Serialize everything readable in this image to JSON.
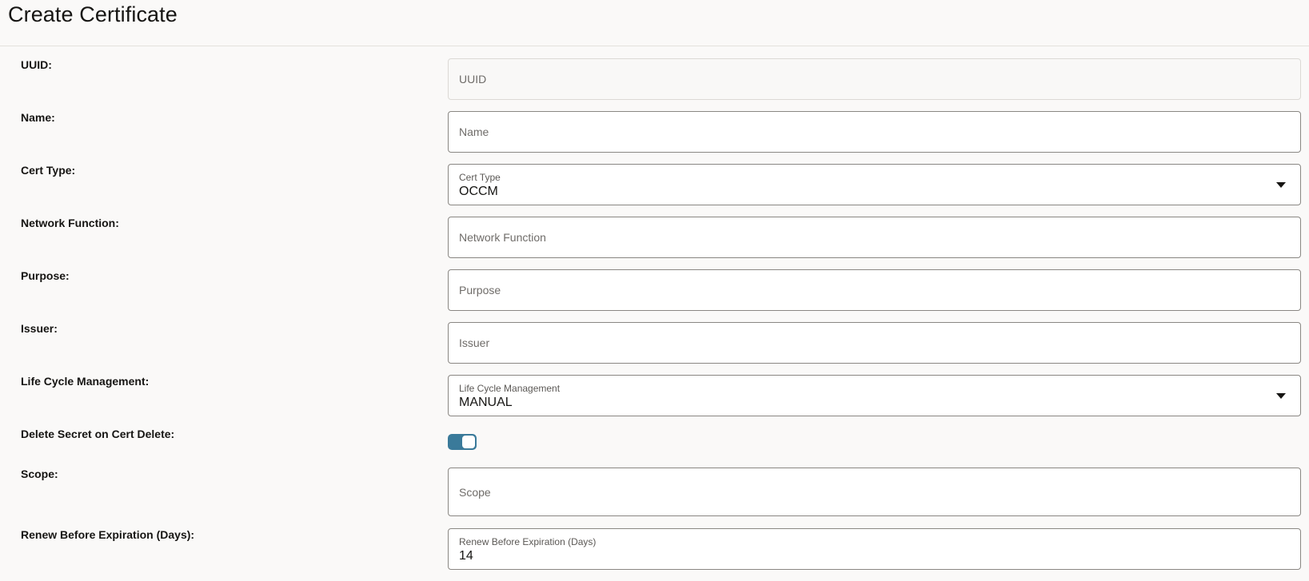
{
  "page": {
    "title": "Create Certificate"
  },
  "form": {
    "uuid": {
      "label": "UUID:",
      "placeholder": "UUID"
    },
    "name": {
      "label": "Name:",
      "placeholder": "Name"
    },
    "cert_type": {
      "label": "Cert Type:",
      "field_label": "Cert Type",
      "value": "OCCM"
    },
    "network_function": {
      "label": "Network Function:",
      "placeholder": "Network Function"
    },
    "purpose": {
      "label": "Purpose:",
      "placeholder": "Purpose"
    },
    "issuer": {
      "label": "Issuer:",
      "placeholder": "Issuer"
    },
    "lifecycle": {
      "label": "Life Cycle Management:",
      "field_label": "Life Cycle Management",
      "value": "MANUAL"
    },
    "delete_secret": {
      "label": "Delete Secret on Cert Delete:",
      "checked": true
    },
    "scope": {
      "label": "Scope:",
      "placeholder": "Scope"
    },
    "renew_before": {
      "label": "Renew Before Expiration (Days):",
      "field_label": "Renew Before Expiration (Days)",
      "value": "14"
    }
  },
  "colors": {
    "toggle_on": "#3a7a9a",
    "border": "#8a8783",
    "background": "#faf9f8"
  },
  "icons": {
    "dropdown": "chevron-down-icon"
  }
}
